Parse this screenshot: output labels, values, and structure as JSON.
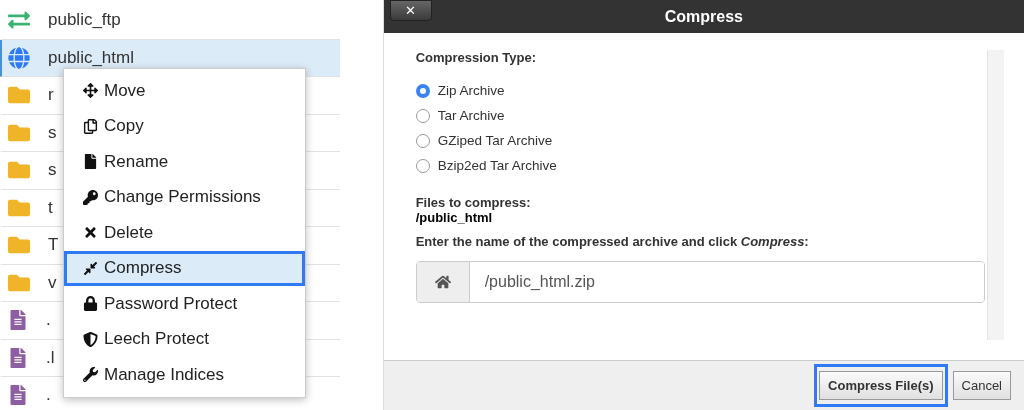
{
  "file_list": [
    {
      "kind": "ftp",
      "name": "public_ftp",
      "selected": false
    },
    {
      "kind": "web",
      "name": "public_html",
      "selected": true
    },
    {
      "kind": "folder",
      "name": "r",
      "selected": false
    },
    {
      "kind": "folder",
      "name": "s",
      "selected": false
    },
    {
      "kind": "folder",
      "name": "s",
      "selected": false
    },
    {
      "kind": "folder",
      "name": "t",
      "selected": false
    },
    {
      "kind": "folder",
      "name": "T",
      "selected": false
    },
    {
      "kind": "folder",
      "name": "v",
      "selected": false
    },
    {
      "kind": "file",
      "name": ".",
      "selected": false
    },
    {
      "kind": "file",
      "name": ".l",
      "selected": false
    },
    {
      "kind": "file",
      "name": ".",
      "selected": false
    }
  ],
  "context_menu": [
    {
      "kind": "move",
      "label": "Move",
      "selected": false
    },
    {
      "kind": "copy",
      "label": "Copy",
      "selected": false
    },
    {
      "kind": "rename",
      "label": "Rename",
      "selected": false
    },
    {
      "kind": "permissions",
      "label": "Change Permissions",
      "selected": false
    },
    {
      "kind": "delete",
      "label": "Delete",
      "selected": false
    },
    {
      "kind": "compress",
      "label": "Compress",
      "selected": true
    },
    {
      "kind": "password",
      "label": "Password Protect",
      "selected": false
    },
    {
      "kind": "leech",
      "label": "Leech Protect",
      "selected": false
    },
    {
      "kind": "indices",
      "label": "Manage Indices",
      "selected": false
    }
  ],
  "dialog": {
    "title": "Compress",
    "close": "✕",
    "type_label": "Compression Type:",
    "types": [
      {
        "label": "Zip Archive",
        "selected": true
      },
      {
        "label": "Tar Archive",
        "selected": false
      },
      {
        "label": "GZiped Tar Archive",
        "selected": false
      },
      {
        "label": "Bzip2ed Tar Archive",
        "selected": false
      }
    ],
    "files_label": "Files to compress:",
    "files_value": "/public_html",
    "name_label": "Enter the name of the compressed archive and click *Compress*:",
    "name_value": "/public_html.zip",
    "buttons": [
      {
        "kind": "primary",
        "label": "Compress File(s)",
        "selected": true
      },
      {
        "kind": "cancel",
        "label": "Cancel",
        "selected": false
      }
    ]
  }
}
